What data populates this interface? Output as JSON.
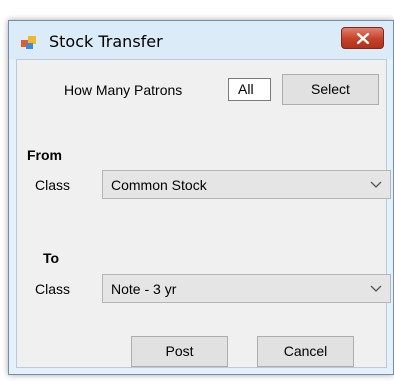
{
  "window": {
    "title": "Stock Transfer"
  },
  "patrons": {
    "label": "How Many Patrons",
    "value": "All",
    "select_label": "Select"
  },
  "from": {
    "heading": "From",
    "class_label": "Class",
    "class_value": "Common Stock"
  },
  "to": {
    "heading": "To",
    "class_label": "Class",
    "class_value": "Note - 3 yr"
  },
  "actions": {
    "post_label": "Post",
    "cancel_label": "Cancel"
  },
  "colors": {
    "close_button": "#c4412a",
    "client_bg": "#f0f0f0",
    "frame_bg": "#dbecf8"
  },
  "icons": {
    "app": "stock-app-icon",
    "close": "close-icon",
    "dropdown": "chevron-down-icon"
  }
}
